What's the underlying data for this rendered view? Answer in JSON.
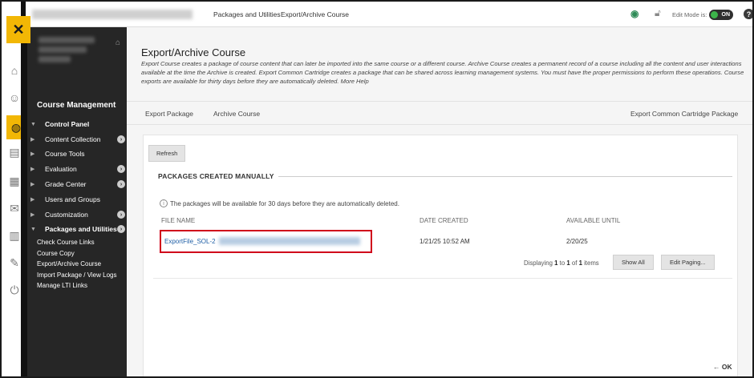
{
  "topbar": {
    "crumb1": "Packages and Utilities",
    "crumb2": "Export/Archive Course",
    "edit_mode_label": "Edit Mode is:",
    "edit_mode_state": "ON",
    "help_glyph": "?"
  },
  "nav": {
    "course_management": "Course Management",
    "control_panel": "Control Panel",
    "items": [
      {
        "label": "Content Collection",
        "has_circle": true
      },
      {
        "label": "Course Tools",
        "has_circle": false
      },
      {
        "label": "Evaluation",
        "has_circle": true
      },
      {
        "label": "Grade Center",
        "has_circle": true
      },
      {
        "label": "Users and Groups",
        "has_circle": false
      },
      {
        "label": "Customization",
        "has_circle": true
      },
      {
        "label": "Packages and Utilities",
        "has_circle": true
      }
    ],
    "sub_links": [
      "Check Course Links",
      "Course Copy",
      "Export/Archive Course",
      "Import Package / View Logs",
      "Manage LTI Links"
    ]
  },
  "page": {
    "title": "Export/Archive Course",
    "description": "Export Course creates a package of course content that can later be imported into the same course or a different course. Archive Course creates a permanent record of a course including all the content and user interactions available at the time the Archive is created. Export Common Cartridge creates a package that can be shared across learning management systems. You must have the proper permissions to perform these operations. Course exports are available for thirty days before they are automatically deleted.",
    "more_help": "More Help"
  },
  "actions": {
    "export_package": "Export Package",
    "archive_course": "Archive Course",
    "export_common_cartridge": "Export Common Cartridge Package"
  },
  "panel": {
    "refresh": "Refresh",
    "section_title": "PACKAGES CREATED MANUALLY",
    "notice": "The packages will be available for 30 days before they are automatically deleted.",
    "columns": {
      "file_name": "FILE NAME",
      "date_created": "DATE CREATED",
      "available_until": "AVAILABLE UNTIL"
    },
    "row": {
      "file_name": "ExportFile_SOL-2",
      "date_created": "1/21/25 10:52 AM",
      "available_until": "2/20/25"
    },
    "paging": {
      "prefix": "Displaying",
      "from": "1",
      "to_word": "to",
      "to": "1",
      "of_word": "of",
      "total": "1",
      "items_word": "items"
    },
    "show_all": "Show All",
    "edit_paging": "Edit Paging...",
    "ok": "OK"
  },
  "colors": {
    "accent_yellow": "#f2b705",
    "nav_dark": "#262626",
    "link_blue": "#1f5fa6",
    "highlight_red": "#d0021b",
    "toggle_green": "#3cb34a"
  }
}
